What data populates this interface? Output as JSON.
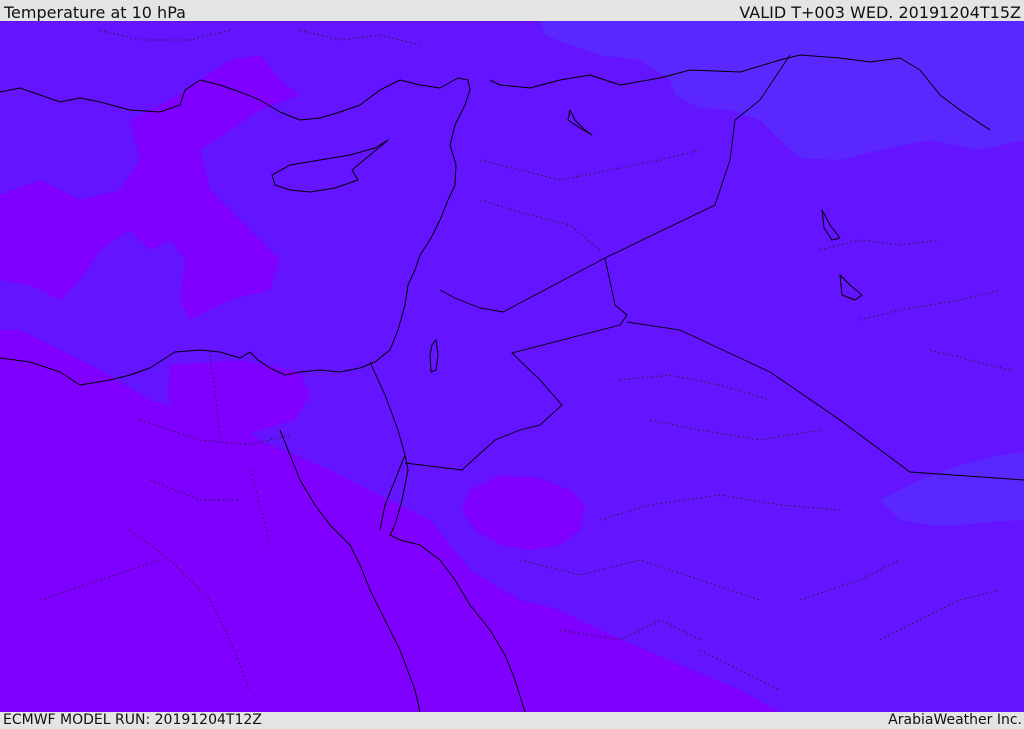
{
  "header": {
    "title": "Temperature at 10 hPa",
    "valid_time": "VALID T+003 WED. 20191204T15Z"
  },
  "footer": {
    "model_run": "ECMWF MODEL RUN: 20191204T12Z",
    "credit": "ArabiaWeather Inc."
  },
  "map": {
    "colors": {
      "violet_field": "#8000ff",
      "indigo_field": "#6414ff",
      "blue_field": "#5a28ff",
      "outline": "#000000"
    }
  }
}
